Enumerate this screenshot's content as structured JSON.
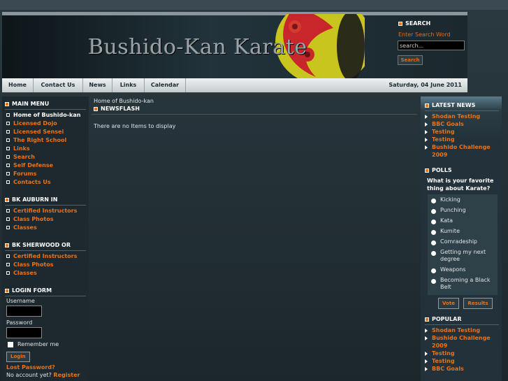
{
  "site": {
    "title": "Bushido-Kan Karate"
  },
  "search": {
    "title": "SEARCH",
    "subtitle": "Enter Search Word",
    "placeholder": "search...",
    "button": "Search"
  },
  "nav": {
    "items": [
      "Home",
      "Contact Us",
      "News",
      "Links",
      "Calendar"
    ],
    "date": "Saturday, 04 June 2011"
  },
  "main_menu": {
    "title": "MAIN MENU",
    "items": [
      "Home of Bushido-kan",
      "Licensed Dojo",
      "Licensed Sensei",
      "The Right School",
      "Links",
      "Search",
      "Self Defense",
      "Forums",
      "Contacts Us"
    ]
  },
  "auburn": {
    "title": "BK AUBURN IN",
    "items": [
      "Certified Instructors",
      "Class Photos",
      "Classes"
    ]
  },
  "sherwood": {
    "title": "BK SHERWOOD OR",
    "items": [
      "Certified Instructors",
      "Class Photos",
      "Classes"
    ]
  },
  "login": {
    "title": "LOGIN FORM",
    "username_label": "Username",
    "password_label": "Password",
    "remember_label": "Remember me",
    "button": "Login",
    "lost_password": "Lost Password?",
    "no_account": "No account yet?",
    "register": "Register"
  },
  "center": {
    "breadcrumb": "Home of Bushido-kan",
    "heading": "NEWSFLASH",
    "message": "There are no Items to display"
  },
  "latest_news": {
    "title": "LATEST NEWS",
    "items": [
      "Shodan Testing",
      "BBC Goals",
      "Testing",
      "Testing",
      "Bushido Challenge 2009"
    ]
  },
  "polls": {
    "title": "POLLS",
    "question": "What is your favorite thing about Karate?",
    "options": [
      "Kicking",
      "Punching",
      "Kata",
      "Kumite",
      "Comradeship",
      "Getting my next degree",
      "Weapons",
      "Becoming a Black Belt"
    ],
    "vote_button": "Vote",
    "results_button": "Results"
  },
  "popular": {
    "title": "POPULAR",
    "items": [
      "Shodan Testing",
      "Bushido Challenge 2009",
      "Testing",
      "Testing",
      "BBC Goals"
    ]
  },
  "colors": {
    "accent": "#e8731a",
    "background": "#1f2b31"
  }
}
